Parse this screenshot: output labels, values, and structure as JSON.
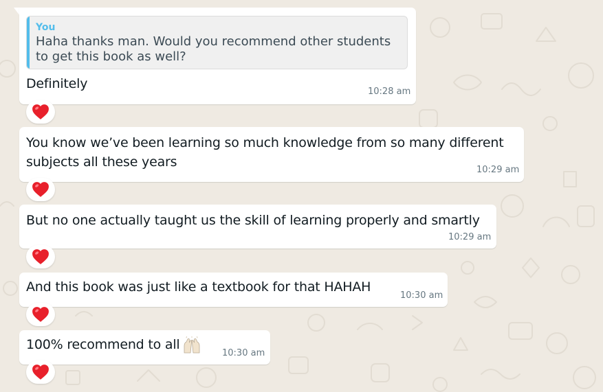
{
  "chat": {
    "colors": {
      "wallpaper": "#efeae2",
      "bubble": "#ffffff",
      "text": "#111b21",
      "timestamp": "#667781",
      "quote_accent": "#53bdeb",
      "heart": "#e8202b"
    },
    "messages": [
      {
        "quoted_sender": "You",
        "quoted_text": "Haha thanks man. Would you recommend other students to get this book as well?",
        "text": "Definitely",
        "time": "10:28 am",
        "reaction": "heart-icon"
      },
      {
        "text_line1": "You know we’ve been learning so much knowledge from so many different",
        "text_line2": "subjects all these years",
        "time": "10:29 am",
        "reaction": "heart-icon"
      },
      {
        "text": "But no one actually taught us the skill of learning properly and smartly",
        "time": "10:29 am",
        "reaction": "heart-icon"
      },
      {
        "text": "And this book was just like a textbook for that HAHAH",
        "time": "10:30 am",
        "reaction": "heart-icon"
      },
      {
        "text": "100% recommend to all",
        "emoji": "raising-hands-emoji",
        "time": "10:30 am",
        "reaction": "heart-icon"
      }
    ]
  }
}
